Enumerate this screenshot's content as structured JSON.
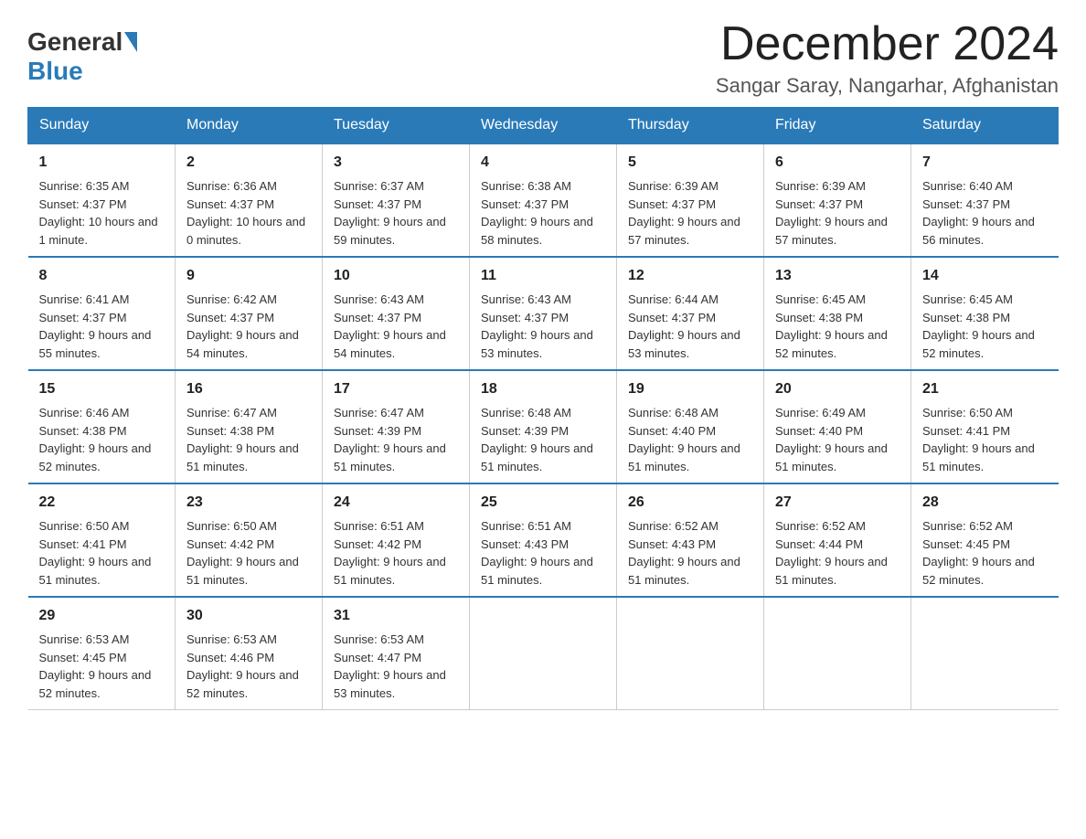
{
  "logo": {
    "general": "General",
    "blue": "Blue"
  },
  "title": "December 2024",
  "location": "Sangar Saray, Nangarhar, Afghanistan",
  "days_of_week": [
    "Sunday",
    "Monday",
    "Tuesday",
    "Wednesday",
    "Thursday",
    "Friday",
    "Saturday"
  ],
  "weeks": [
    [
      {
        "day": "1",
        "sunrise": "6:35 AM",
        "sunset": "4:37 PM",
        "daylight": "10 hours and 1 minute."
      },
      {
        "day": "2",
        "sunrise": "6:36 AM",
        "sunset": "4:37 PM",
        "daylight": "10 hours and 0 minutes."
      },
      {
        "day": "3",
        "sunrise": "6:37 AM",
        "sunset": "4:37 PM",
        "daylight": "9 hours and 59 minutes."
      },
      {
        "day": "4",
        "sunrise": "6:38 AM",
        "sunset": "4:37 PM",
        "daylight": "9 hours and 58 minutes."
      },
      {
        "day": "5",
        "sunrise": "6:39 AM",
        "sunset": "4:37 PM",
        "daylight": "9 hours and 57 minutes."
      },
      {
        "day": "6",
        "sunrise": "6:39 AM",
        "sunset": "4:37 PM",
        "daylight": "9 hours and 57 minutes."
      },
      {
        "day": "7",
        "sunrise": "6:40 AM",
        "sunset": "4:37 PM",
        "daylight": "9 hours and 56 minutes."
      }
    ],
    [
      {
        "day": "8",
        "sunrise": "6:41 AM",
        "sunset": "4:37 PM",
        "daylight": "9 hours and 55 minutes."
      },
      {
        "day": "9",
        "sunrise": "6:42 AM",
        "sunset": "4:37 PM",
        "daylight": "9 hours and 54 minutes."
      },
      {
        "day": "10",
        "sunrise": "6:43 AM",
        "sunset": "4:37 PM",
        "daylight": "9 hours and 54 minutes."
      },
      {
        "day": "11",
        "sunrise": "6:43 AM",
        "sunset": "4:37 PM",
        "daylight": "9 hours and 53 minutes."
      },
      {
        "day": "12",
        "sunrise": "6:44 AM",
        "sunset": "4:37 PM",
        "daylight": "9 hours and 53 minutes."
      },
      {
        "day": "13",
        "sunrise": "6:45 AM",
        "sunset": "4:38 PM",
        "daylight": "9 hours and 52 minutes."
      },
      {
        "day": "14",
        "sunrise": "6:45 AM",
        "sunset": "4:38 PM",
        "daylight": "9 hours and 52 minutes."
      }
    ],
    [
      {
        "day": "15",
        "sunrise": "6:46 AM",
        "sunset": "4:38 PM",
        "daylight": "9 hours and 52 minutes."
      },
      {
        "day": "16",
        "sunrise": "6:47 AM",
        "sunset": "4:38 PM",
        "daylight": "9 hours and 51 minutes."
      },
      {
        "day": "17",
        "sunrise": "6:47 AM",
        "sunset": "4:39 PM",
        "daylight": "9 hours and 51 minutes."
      },
      {
        "day": "18",
        "sunrise": "6:48 AM",
        "sunset": "4:39 PM",
        "daylight": "9 hours and 51 minutes."
      },
      {
        "day": "19",
        "sunrise": "6:48 AM",
        "sunset": "4:40 PM",
        "daylight": "9 hours and 51 minutes."
      },
      {
        "day": "20",
        "sunrise": "6:49 AM",
        "sunset": "4:40 PM",
        "daylight": "9 hours and 51 minutes."
      },
      {
        "day": "21",
        "sunrise": "6:50 AM",
        "sunset": "4:41 PM",
        "daylight": "9 hours and 51 minutes."
      }
    ],
    [
      {
        "day": "22",
        "sunrise": "6:50 AM",
        "sunset": "4:41 PM",
        "daylight": "9 hours and 51 minutes."
      },
      {
        "day": "23",
        "sunrise": "6:50 AM",
        "sunset": "4:42 PM",
        "daylight": "9 hours and 51 minutes."
      },
      {
        "day": "24",
        "sunrise": "6:51 AM",
        "sunset": "4:42 PM",
        "daylight": "9 hours and 51 minutes."
      },
      {
        "day": "25",
        "sunrise": "6:51 AM",
        "sunset": "4:43 PM",
        "daylight": "9 hours and 51 minutes."
      },
      {
        "day": "26",
        "sunrise": "6:52 AM",
        "sunset": "4:43 PM",
        "daylight": "9 hours and 51 minutes."
      },
      {
        "day": "27",
        "sunrise": "6:52 AM",
        "sunset": "4:44 PM",
        "daylight": "9 hours and 51 minutes."
      },
      {
        "day": "28",
        "sunrise": "6:52 AM",
        "sunset": "4:45 PM",
        "daylight": "9 hours and 52 minutes."
      }
    ],
    [
      {
        "day": "29",
        "sunrise": "6:53 AM",
        "sunset": "4:45 PM",
        "daylight": "9 hours and 52 minutes."
      },
      {
        "day": "30",
        "sunrise": "6:53 AM",
        "sunset": "4:46 PM",
        "daylight": "9 hours and 52 minutes."
      },
      {
        "day": "31",
        "sunrise": "6:53 AM",
        "sunset": "4:47 PM",
        "daylight": "9 hours and 53 minutes."
      },
      null,
      null,
      null,
      null
    ]
  ]
}
